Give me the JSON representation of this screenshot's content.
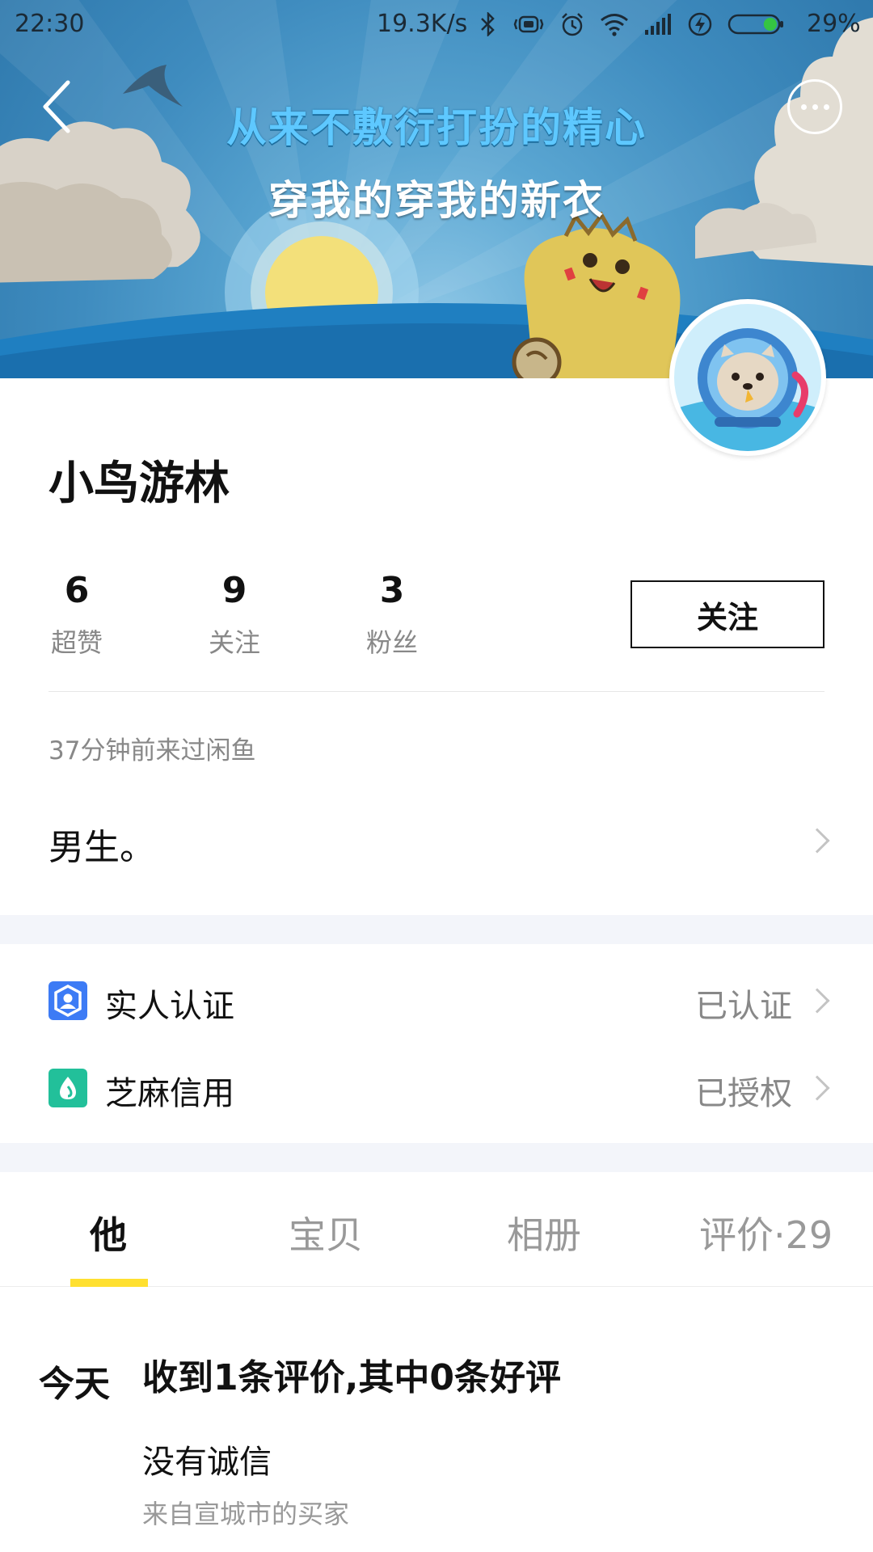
{
  "status_bar": {
    "time": "22:30",
    "net_speed": "19.3K/s",
    "icons": [
      "bluetooth-icon",
      "vibrate-icon",
      "alarm-icon",
      "wifi-icon",
      "signal-icon",
      "charging-icon",
      "battery-icon"
    ],
    "battery_percent": "29%",
    "battery_level": 0.29
  },
  "banner": {
    "slogan_line1": "从来不敷衍打扮的精心",
    "slogan_line2": "穿我的穿我的新衣",
    "back_icon": "back-arrow-icon",
    "more_icon": "more-dots-icon"
  },
  "profile": {
    "username": "小鸟游林",
    "stats": [
      {
        "value": "6",
        "label": "超赞"
      },
      {
        "value": "9",
        "label": "关注"
      },
      {
        "value": "3",
        "label": "粉丝"
      }
    ],
    "follow_label": "关注",
    "last_seen": "37分钟前来过闲鱼",
    "bio": "男生。"
  },
  "certifications": [
    {
      "title": "实人认证",
      "status": "已认证",
      "icon": "real-person-verify-icon",
      "color": "#3d7bf5"
    },
    {
      "title": "芝麻信用",
      "status": "已授权",
      "icon": "sesame-credit-icon",
      "color": "#22c09a"
    }
  ],
  "tabs": [
    "他",
    "宝贝",
    "相册",
    "评价·29"
  ],
  "active_tab": 0,
  "accent_color": "#ffe030",
  "feed": {
    "date": "今天",
    "title": "收到1条评价,其中0条好评",
    "comment": "没有诚信",
    "source": "来自宣城市的买家"
  }
}
